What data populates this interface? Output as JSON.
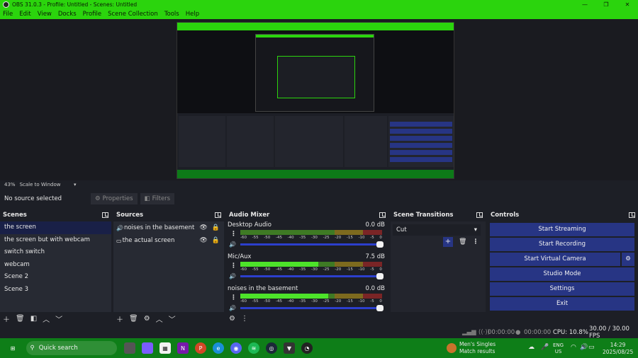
{
  "window": {
    "title": "OBS 31.0.3 - Profile: Untitled - Scenes: Untitled",
    "minimize": "—",
    "maximize": "❐",
    "close": "✕"
  },
  "menu": [
    "File",
    "Edit",
    "View",
    "Docks",
    "Profile",
    "Scene Collection",
    "Tools",
    "Help"
  ],
  "preview": {
    "zoom": "43%",
    "scale_mode": "Scale to Window"
  },
  "source_toolbar": {
    "status": "No source selected",
    "properties": "Properties",
    "filters": "Filters"
  },
  "scenes": {
    "title": "Scenes",
    "items": [
      "the screen",
      "the screen but with webcam",
      "switch switch",
      "webcam",
      "Scene 2",
      "Scene 3"
    ],
    "active_index": 0
  },
  "sources": {
    "title": "Sources",
    "items": [
      {
        "name": "noises in the basement",
        "icon": "speaker-icon"
      },
      {
        "name": "the actual screen",
        "icon": "monitor-icon"
      }
    ]
  },
  "mixer": {
    "title": "Audio Mixer",
    "ticks": [
      "-60",
      "-55",
      "-50",
      "-45",
      "-40",
      "-35",
      "-30",
      "-25",
      "-20",
      "-15",
      "-10",
      "-5",
      "0"
    ],
    "channels": [
      {
        "name": "Desktop Audio",
        "db": "0.0 dB",
        "level": 0.0,
        "volume": 1.0
      },
      {
        "name": "Mic/Aux",
        "db": "7.5 dB",
        "level": 0.55,
        "volume": 1.0
      },
      {
        "name": "noises in the basement",
        "db": "0.0 dB",
        "level": 0.62,
        "volume": 1.0
      }
    ]
  },
  "transitions": {
    "title": "Scene Transitions",
    "selected": "Cut"
  },
  "controls": {
    "title": "Controls",
    "buttons": [
      "Start Streaming",
      "Start Recording",
      "Start Virtual Camera",
      "Studio Mode",
      "Settings",
      "Exit"
    ]
  },
  "status": {
    "stream_time": "00:00:00",
    "rec_time": "00:00:00",
    "cpu": "CPU: 10.8%",
    "fps": "30.00 / 30.00 FPS"
  },
  "taskbar": {
    "search": "Quick search",
    "weather_title": "Men's Singles",
    "weather_sub": "Match results",
    "lang": "ENG",
    "region": "US",
    "time": "14:29",
    "date": "2025/08/25"
  },
  "colors": {
    "accent_green": "#2bd40d",
    "button_blue": "#273584",
    "panel_bg": "#272a33",
    "taskbar_green": "#0e7e18"
  }
}
